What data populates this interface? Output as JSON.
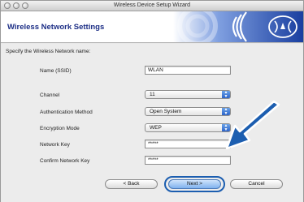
{
  "window": {
    "title": "Wireless Device Setup Wizard"
  },
  "header": {
    "title": "Wireless Network Settings"
  },
  "instruction": "Specify the Wireless Network name:",
  "fields": {
    "ssid": {
      "label": "Name (SSID)",
      "value": "WLAN"
    },
    "channel": {
      "label": "Channel",
      "value": "11"
    },
    "auth": {
      "label": "Authentication Method",
      "value": "Open System"
    },
    "encryption": {
      "label": "Encryption Mode",
      "value": "WEP"
    },
    "network_key": {
      "label": "Network Key",
      "value": "*****"
    },
    "confirm_key": {
      "label": "Confirm Network Key",
      "value": "*****"
    }
  },
  "buttons": {
    "back": "< Back",
    "next": "Next >",
    "cancel": "Cancel"
  },
  "colors": {
    "header_title": "#1d2f86",
    "banner_blue": "#1a3fa0",
    "arrow_blue": "#1c5eb0"
  },
  "icons": {
    "banner": "wireless-waves-icon",
    "pointer": "pointer-arrow-icon"
  }
}
